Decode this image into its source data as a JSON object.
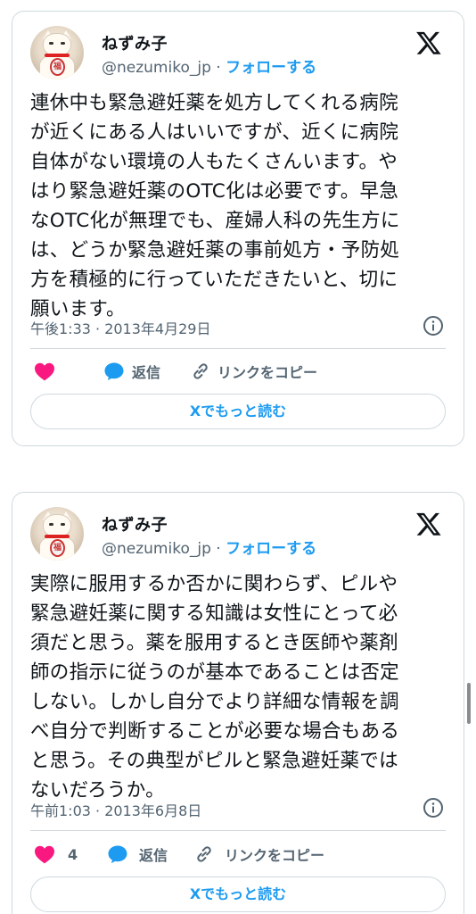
{
  "tweets": [
    {
      "user": {
        "name": "ねずみ子",
        "handle": "@nezumiko_jp",
        "separator": " · ",
        "follow": "フォローする"
      },
      "lines": [
        "連休中も緊急避妊薬を処方してくれる病院",
        "が近くにある人はいいですが、近くに病院",
        "自体がない環境の人もたくさんいます。や",
        "はり緊急避妊薬のOTC化は必要です。早急",
        "なOTC化が無理でも、産婦人科の先生方に",
        "は、どうか緊急避妊薬の事前処方・予防処",
        "方を積極的に行っていただきたいと、切に",
        "願います。"
      ],
      "timestamp": "午後1:33 · 2013年4月29日",
      "like_count": "",
      "reply_label": "返信",
      "copy_link_label": "リンクをコピー",
      "read_more": "Xでもっと読む"
    },
    {
      "user": {
        "name": "ねずみ子",
        "handle": "@nezumiko_jp",
        "separator": " · ",
        "follow": "フォローする"
      },
      "lines": [
        "実際に服用するか否かに関わらず、ピルや",
        "緊急避妊薬に関する知識は女性にとって必",
        "須だと思う。薬を服用するとき医師や薬剤",
        "師の指示に従うのが基本であることは否定",
        "しない。しかし自分でより詳細な情報を調",
        "べ自分で判断することが必要な場合もある",
        "と思う。その典型がピルと緊急避妊薬では",
        "ないだろうか。"
      ],
      "timestamp": "午前1:03 · 2013年6月8日",
      "like_count": "4",
      "reply_label": "返信",
      "copy_link_label": "リンクをコピー",
      "read_more": "Xでもっと読む"
    }
  ],
  "colors": {
    "accent": "#1d9bf0",
    "like": "#f91880",
    "muted": "#536471",
    "border": "#cfd9de"
  },
  "avatar_coin_text": "福"
}
